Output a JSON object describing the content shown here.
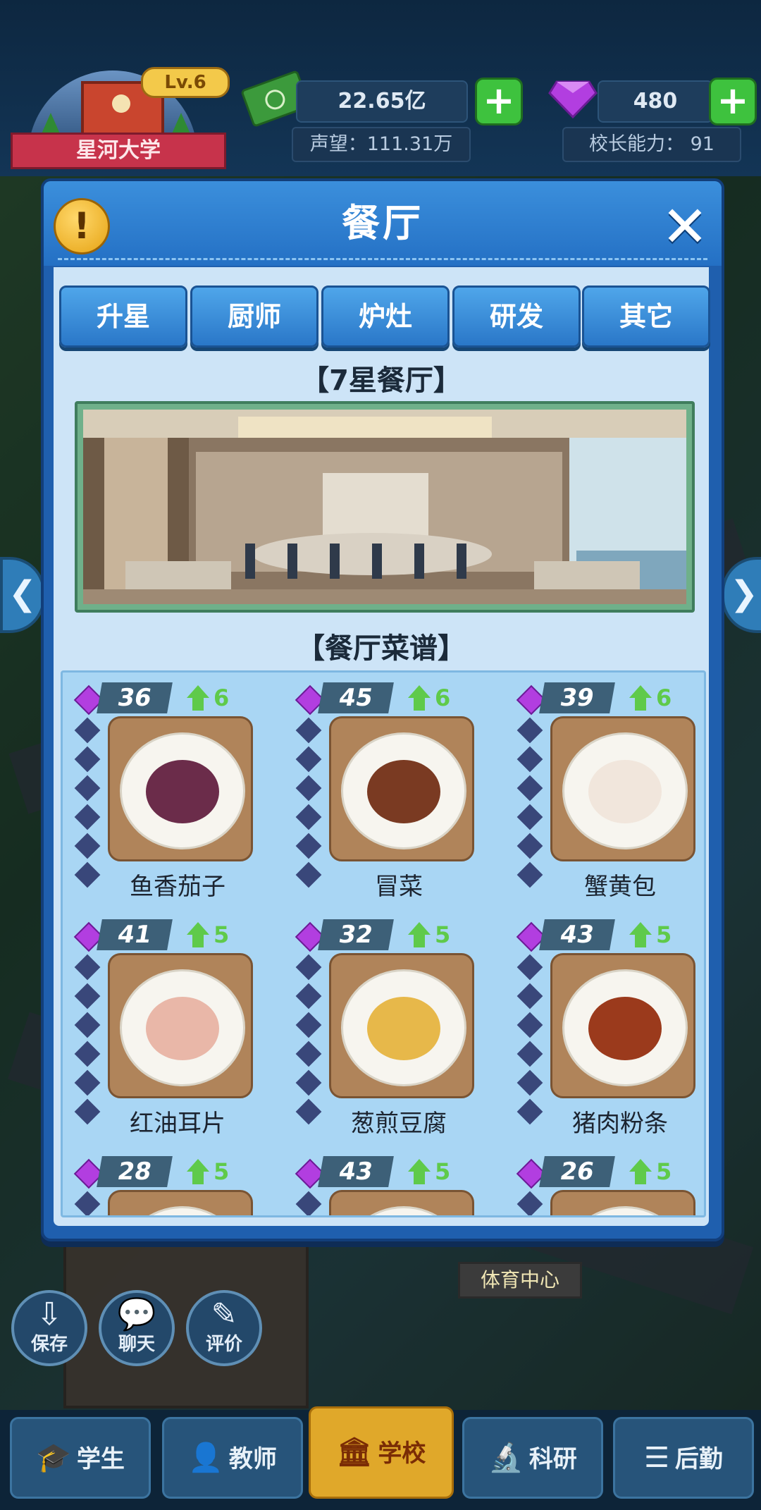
{
  "hud": {
    "school_level": "Lv.6",
    "school_name": "星河大学",
    "money": "22.65亿",
    "reputation": "声望：111.31万",
    "gems": "480",
    "principal_ability": "校长能力： 91",
    "plus_label": "+"
  },
  "modal": {
    "title": "餐厅",
    "alert_glyph": "!",
    "close_glyph": "✕",
    "tabs": [
      "升星",
      "厨师",
      "炉灶",
      "研发",
      "其它"
    ],
    "restaurant_title": "【7星餐厅】",
    "menu_title": "【餐厅菜谱】",
    "recipes": [
      {
        "name": "鱼香茄子",
        "level": "36",
        "up": "6",
        "food_color": "#6b2c4a"
      },
      {
        "name": "冒菜",
        "level": "45",
        "up": "6",
        "food_color": "#7a3a22"
      },
      {
        "name": "蟹黄包",
        "level": "39",
        "up": "6",
        "food_color": "#f1e6dc"
      },
      {
        "name": "红油耳片",
        "level": "41",
        "up": "5",
        "food_color": "#e9b7a8"
      },
      {
        "name": "葱煎豆腐",
        "level": "32",
        "up": "5",
        "food_color": "#e7b84a"
      },
      {
        "name": "猪肉粉条",
        "level": "43",
        "up": "5",
        "food_color": "#9b3a1c"
      },
      {
        "name": "",
        "level": "28",
        "up": "5",
        "food_color": "#b0845a"
      },
      {
        "name": "",
        "level": "43",
        "up": "5",
        "food_color": "#b0845a"
      },
      {
        "name": "",
        "level": "26",
        "up": "5",
        "food_color": "#b0845a"
      }
    ]
  },
  "side": {
    "left_arrow": "❮",
    "right_arrow": "❯"
  },
  "bottom": {
    "save": "保存",
    "chat": "聊天",
    "review": "评价",
    "sports_center": "体育中心",
    "tabs": [
      {
        "label": "学生",
        "icon": "graduation-cap-icon",
        "glyph": "🎓"
      },
      {
        "label": "教师",
        "icon": "teacher-icon",
        "glyph": "👤"
      },
      {
        "label": "学校",
        "icon": "school-building-icon",
        "glyph": "🏛"
      },
      {
        "label": "科研",
        "icon": "microscope-icon",
        "glyph": "🔬"
      },
      {
        "label": "后勤",
        "icon": "logistics-icon",
        "glyph": "☰"
      }
    ]
  },
  "colors": {
    "modal_blue": "#1f5fae",
    "panel": "#cde4f7",
    "active_tab": "#e0a82a",
    "level_up_green": "#5fca4a",
    "gem_purple": "#b23ee0"
  }
}
